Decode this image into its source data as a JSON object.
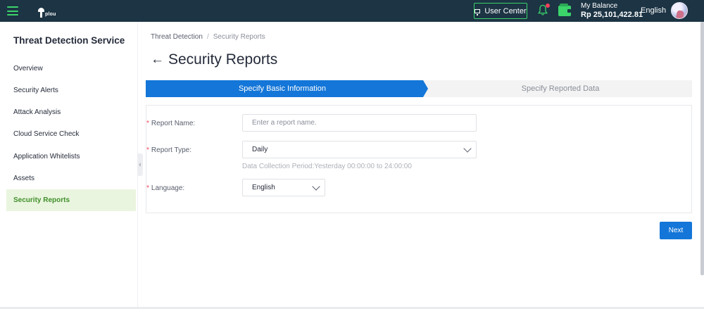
{
  "topbar": {
    "logo_text": "plou",
    "user_center_label": "User Center",
    "balance_label": "My Balance",
    "balance_amount": "Rp 25,101,422.81",
    "language": "English",
    "colors": {
      "bar": "#1c3444",
      "accent": "#3bd36a",
      "notification": "#f5425b"
    }
  },
  "sidebar": {
    "title": "Threat Detection Service",
    "items": [
      {
        "label": "Overview",
        "active": false
      },
      {
        "label": "Security Alerts",
        "active": false
      },
      {
        "label": "Attack Analysis",
        "active": false
      },
      {
        "label": "Cloud Service Check",
        "active": false
      },
      {
        "label": "Application Whitelists",
        "active": false
      },
      {
        "label": "Assets",
        "active": false
      },
      {
        "label": "Security Reports",
        "active": true
      }
    ]
  },
  "breadcrumb": {
    "root": "Threat Detection",
    "separator": "/",
    "current": "Security Reports"
  },
  "page": {
    "title": "Security Reports",
    "back_icon": "arrow-left-icon"
  },
  "steps": [
    {
      "label": "Specify Basic Information",
      "active": true
    },
    {
      "label": "Specify Reported Data",
      "active": false
    }
  ],
  "form": {
    "report_name": {
      "label": "Report Name:",
      "value": "",
      "placeholder": "Enter a report name."
    },
    "report_type": {
      "label": "Report Type:",
      "value": "Daily"
    },
    "hint": "Data Collection Period:Yesterday 00:00:00 to 24:00:00",
    "language": {
      "label": "Language:",
      "value": "English"
    },
    "required_mark": "*"
  },
  "actions": {
    "next_label": "Next"
  },
  "colors": {
    "primary": "#1476d8",
    "active_sidebar_bg": "#eaf5df",
    "active_sidebar_text": "#3f8f2a"
  }
}
